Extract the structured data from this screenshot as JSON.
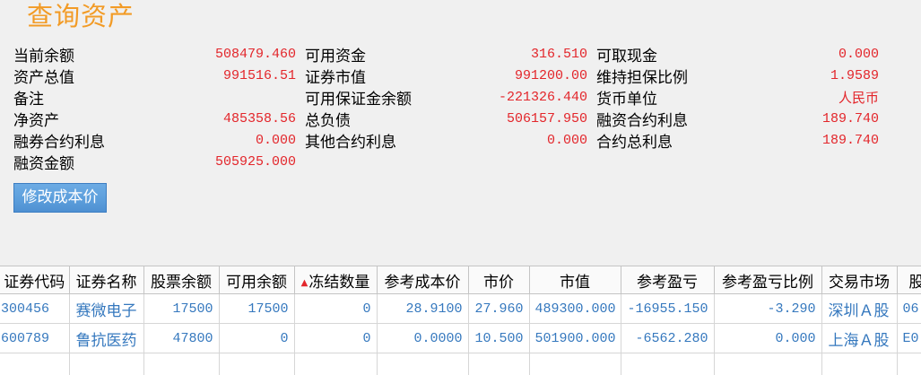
{
  "title": "查询资产",
  "summary": [
    {
      "label": "当前余额",
      "value": "508479.460"
    },
    {
      "label": "可用资金",
      "value": "316.510"
    },
    {
      "label": "可取现金",
      "value": "0.000"
    },
    {
      "label": "资产总值",
      "value": "991516.51"
    },
    {
      "label": "证券市值",
      "value": "991200.00"
    },
    {
      "label": "维持担保比例",
      "value": "1.9589"
    },
    {
      "label": "备注",
      "value": ""
    },
    {
      "label": "可用保证金余额",
      "value": "-221326.440"
    },
    {
      "label": "货币单位",
      "value": "人民币"
    },
    {
      "label": "净资产",
      "value": "485358.56"
    },
    {
      "label": "总负债",
      "value": "506157.950"
    },
    {
      "label": "融资合约利息",
      "value": "189.740"
    },
    {
      "label": "融券合约利息",
      "value": "0.000"
    },
    {
      "label": "其他合约利息",
      "value": "0.000"
    },
    {
      "label": "合约总利息",
      "value": "189.740"
    },
    {
      "label": "融资金额",
      "value": "505925.000"
    }
  ],
  "actions": {
    "modify_cost_price": "修改成本价"
  },
  "positions": {
    "sort_icon": "sort-ascending-icon",
    "sort_glyph": "▲",
    "columns": [
      "证券代码",
      "证券名称",
      "股票余额",
      "可用余额",
      "冻结数量",
      "参考成本价",
      "市价",
      "市值",
      "参考盈亏",
      "参考盈亏比例",
      "交易市场",
      "股"
    ],
    "rows": [
      [
        "300456",
        "赛微电子",
        "17500",
        "17500",
        "0",
        "28.9100",
        "27.960",
        "489300.000",
        "-16955.150",
        "-3.290",
        "深圳Ａ股",
        "06"
      ],
      [
        "600789",
        "鲁抗医药",
        "47800",
        "0",
        "0",
        "0.0000",
        "10.500",
        "501900.000",
        "-6562.280",
        "0.000",
        "上海Ａ股",
        "E0"
      ]
    ]
  },
  "colors": {
    "title": "#f29b26",
    "value": "#e3262b",
    "cell_text": "#3578be",
    "button": "#5d9fdc"
  }
}
